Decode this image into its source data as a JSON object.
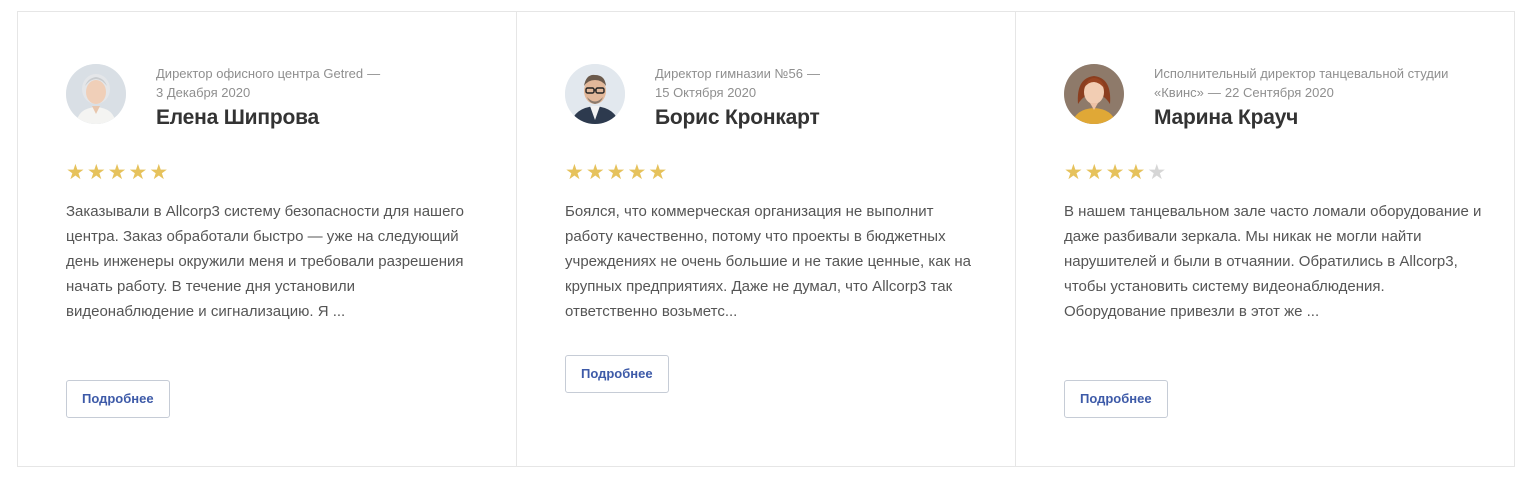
{
  "reviews": [
    {
      "meta": "Директор офисного центра Getred",
      "date": "3 Декабря 2020",
      "name": "Елена Шипрова",
      "rating": 5,
      "text": "Заказывали в Allcorp3 систему безопасности для нашего центра. Заказ обработали быстро — уже на следующий день инженеры окружили меня и требовали разрешения начать работу. В течение дня установили видеонаблюдение и сигнализацию. Я ...",
      "button": "Подробнее",
      "avatar_icon": "woman-gray-hair-avatar"
    },
    {
      "meta": "Директор гимназии №56",
      "date": "15 Октября 2020",
      "name": "Борис Кронкарт",
      "rating": 5,
      "text": "Боялся, что коммерческая организация не выполнит работу качественно, потому что проекты в бюджетных учреждениях не очень большие и не такие ценные, как на крупных предприятиях. Даже не думал, что Allcorp3 так ответственно возьметс...",
      "button": "Подробнее",
      "avatar_icon": "man-glasses-avatar"
    },
    {
      "meta": "Исполнительный директор танцевальной студии «Квинс»",
      "date": "22 Сентября 2020",
      "name": "Марина Крауч",
      "rating": 4,
      "text": "В нашем танцевальном зале часто ломали оборудование и даже разбивали зеркала. Мы никак не могли найти нарушителей и были в отчаянии. Обратились в Allcorp3, чтобы установить систему видеонаблюдения. Оборудование привезли в этот же ...",
      "button": "Подробнее",
      "avatar_icon": "woman-red-hair-avatar"
    }
  ],
  "rating_max": 5,
  "colors": {
    "star_on": "#e6c25c",
    "star_off": "#d6d6d6",
    "accent": "#3d5aa8",
    "border": "#e6e6e6"
  }
}
